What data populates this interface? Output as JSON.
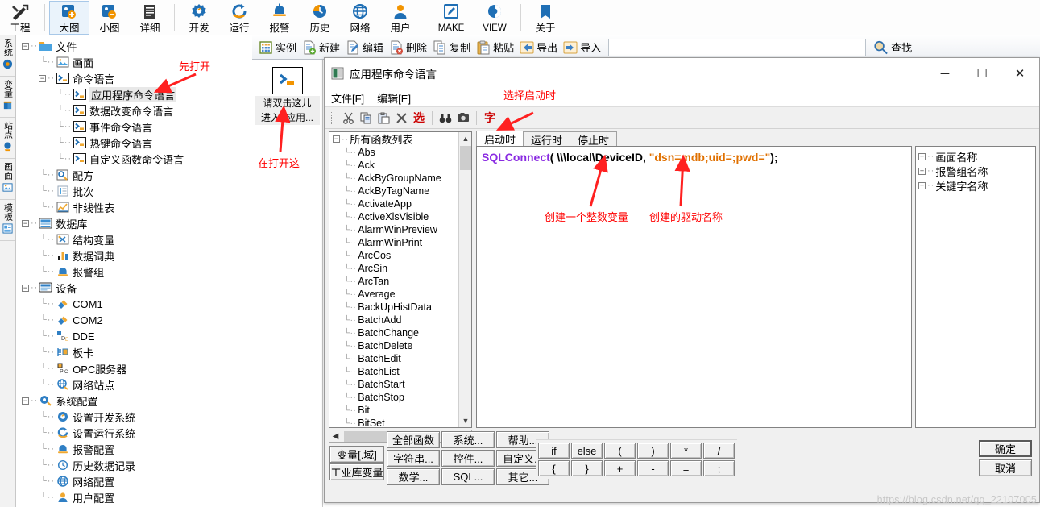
{
  "ribbon": {
    "items": [
      {
        "label": "工程",
        "icon": "tools-icon",
        "selected": false,
        "latin": false
      },
      {
        "label": "大图",
        "icon": "large-icon-view-icon",
        "selected": true,
        "latin": false
      },
      {
        "label": "小图",
        "icon": "small-icon-view-icon",
        "selected": false,
        "latin": false
      },
      {
        "label": "详细",
        "icon": "details-view-icon",
        "selected": false,
        "latin": false
      },
      {
        "label": "开发",
        "icon": "develop-icon",
        "selected": false,
        "latin": false
      },
      {
        "label": "运行",
        "icon": "run-icon",
        "selected": false,
        "latin": false
      },
      {
        "label": "报警",
        "icon": "alarm-bell-icon",
        "selected": false,
        "latin": false
      },
      {
        "label": "历史",
        "icon": "history-clock-icon",
        "selected": false,
        "latin": false
      },
      {
        "label": "网络",
        "icon": "network-globe-icon",
        "selected": false,
        "latin": false
      },
      {
        "label": "用户",
        "icon": "user-icon",
        "selected": false,
        "latin": false
      },
      {
        "label": "MAKE",
        "icon": "make-pencil-icon",
        "selected": false,
        "latin": true
      },
      {
        "label": "VIEW",
        "icon": "view-eye-icon",
        "selected": false,
        "latin": true
      },
      {
        "label": "关于",
        "icon": "about-book-icon",
        "selected": false,
        "latin": false
      }
    ]
  },
  "toolbar2": {
    "items": [
      {
        "label": "实例",
        "icon": "instance-grid-icon"
      },
      {
        "label": "新建",
        "icon": "new-file-icon"
      },
      {
        "label": "编辑",
        "icon": "edit-file-icon"
      },
      {
        "label": "删除",
        "icon": "delete-file-icon"
      },
      {
        "label": "复制",
        "icon": "copy-icon"
      },
      {
        "label": "粘贴",
        "icon": "paste-icon"
      },
      {
        "label": "导出",
        "icon": "export-arrow-icon"
      },
      {
        "label": "导入",
        "icon": "import-arrow-icon"
      }
    ],
    "search_label": "查找",
    "search_icon": "search-icon",
    "search_value": ""
  },
  "vertical_tabs": [
    {
      "label": "系统",
      "icon": "system-gear-icon"
    },
    {
      "label": "变量",
      "icon": "variable-book-icon"
    },
    {
      "label": "站点",
      "icon": "site-satellite-icon"
    },
    {
      "label": "画面",
      "icon": "picture-icon"
    },
    {
      "label": "模板",
      "icon": "template-icon"
    }
  ],
  "tree": [
    {
      "label": "文件",
      "depth": 0,
      "icon": "folder-icon",
      "expander": "minus",
      "selected": false
    },
    {
      "label": "画面",
      "depth": 1,
      "icon": "picture-icon",
      "expander": "",
      "selected": false
    },
    {
      "label": "命令语言",
      "depth": 1,
      "icon": "command-language-icon",
      "expander": "minus",
      "selected": false
    },
    {
      "label": "应用程序命令语言",
      "depth": 2,
      "icon": "command-language-icon",
      "expander": "",
      "selected": true
    },
    {
      "label": "数据改变命令语言",
      "depth": 2,
      "icon": "command-language-icon",
      "expander": "",
      "selected": false
    },
    {
      "label": "事件命令语言",
      "depth": 2,
      "icon": "command-language-icon",
      "expander": "",
      "selected": false
    },
    {
      "label": "热键命令语言",
      "depth": 2,
      "icon": "command-language-icon",
      "expander": "",
      "selected": false
    },
    {
      "label": "自定义函数命令语言",
      "depth": 2,
      "icon": "command-language-icon",
      "expander": "",
      "selected": false
    },
    {
      "label": "配方",
      "depth": 1,
      "icon": "recipe-icon",
      "expander": "",
      "selected": false
    },
    {
      "label": "批次",
      "depth": 1,
      "icon": "batch-icon",
      "expander": "",
      "selected": false
    },
    {
      "label": "非线性表",
      "depth": 1,
      "icon": "nonlinear-table-icon",
      "expander": "",
      "selected": false
    },
    {
      "label": "数据库",
      "depth": 0,
      "icon": "database-icon",
      "expander": "minus",
      "selected": false
    },
    {
      "label": "结构变量",
      "depth": 1,
      "icon": "struct-variable-icon",
      "expander": "",
      "selected": false
    },
    {
      "label": "数据词典",
      "depth": 1,
      "icon": "data-dictionary-icon",
      "expander": "",
      "selected": false
    },
    {
      "label": "报警组",
      "depth": 1,
      "icon": "alarm-group-icon",
      "expander": "",
      "selected": false
    },
    {
      "label": "设备",
      "depth": 0,
      "icon": "device-monitor-icon",
      "expander": "minus",
      "selected": false
    },
    {
      "label": "COM1",
      "depth": 1,
      "icon": "com-port-icon",
      "expander": "",
      "selected": false
    },
    {
      "label": "COM2",
      "depth": 1,
      "icon": "com-port-icon",
      "expander": "",
      "selected": false
    },
    {
      "label": "DDE",
      "depth": 1,
      "icon": "dde-icon",
      "expander": "",
      "selected": false
    },
    {
      "label": "板卡",
      "depth": 1,
      "icon": "board-card-icon",
      "expander": "",
      "selected": false
    },
    {
      "label": "OPC服务器",
      "depth": 1,
      "icon": "opc-server-icon",
      "expander": "",
      "selected": false
    },
    {
      "label": "网络站点",
      "depth": 1,
      "icon": "network-site-icon",
      "expander": "",
      "selected": false
    },
    {
      "label": "系统配置",
      "depth": 0,
      "icon": "system-config-icon",
      "expander": "minus",
      "selected": false
    },
    {
      "label": "设置开发系统",
      "depth": 1,
      "icon": "develop-icon",
      "expander": "",
      "selected": false
    },
    {
      "label": "设置运行系统",
      "depth": 1,
      "icon": "run-icon",
      "expander": "",
      "selected": false
    },
    {
      "label": "报警配置",
      "depth": 1,
      "icon": "alarm-bell-icon",
      "expander": "",
      "selected": false
    },
    {
      "label": "历史数据记录",
      "depth": 1,
      "icon": "history-clock-icon",
      "expander": "",
      "selected": false
    },
    {
      "label": "网络配置",
      "depth": 1,
      "icon": "network-globe-icon",
      "expander": "",
      "selected": false
    },
    {
      "label": "用户配置",
      "depth": 1,
      "icon": "user-icon",
      "expander": "",
      "selected": false
    }
  ],
  "instance_pane": {
    "icon": "command-language-icon",
    "line1": "请双击这儿",
    "line2": "进入<应用..."
  },
  "dialog": {
    "title": "应用程序命令语言",
    "title_icon": "app-window-icon",
    "window_buttons": {
      "minimize": "─",
      "maximize": "☐",
      "close": "✕"
    },
    "menu": [
      "文件[F]",
      "编辑[E]"
    ],
    "toolbar": [
      {
        "icon": "cut-icon",
        "kind": "icon"
      },
      {
        "icon": "copy-icon",
        "kind": "icon"
      },
      {
        "icon": "paste-icon",
        "kind": "icon"
      },
      {
        "icon": "delete-x-icon",
        "kind": "icon"
      },
      {
        "icon": "select-text-icon",
        "kind": "text",
        "label": "选"
      },
      {
        "icon": "find-binoculars-icon",
        "kind": "icon"
      },
      {
        "icon": "camera-icon",
        "kind": "icon"
      },
      {
        "icon": "font-text-icon",
        "kind": "text",
        "label": "字"
      }
    ],
    "function_list": {
      "root": "所有函数列表",
      "items": [
        "Abs",
        "Ack",
        "AckByGroupName",
        "AckByTagName",
        "ActivateApp",
        "ActiveXlsVisible",
        "AlarmWinPreview",
        "AlarmWinPrint",
        "ArcCos",
        "ArcSin",
        "ArcTan",
        "Average",
        "BackUpHistData",
        "BatchAdd",
        "BatchChange",
        "BatchDelete",
        "BatchEdit",
        "BatchList",
        "BatchStart",
        "BatchStop",
        "Bit",
        "BitSet"
      ]
    },
    "tabs": [
      {
        "label": "启动时",
        "active": true
      },
      {
        "label": "运行时",
        "active": false
      },
      {
        "label": "停止时",
        "active": false
      }
    ],
    "code": {
      "fn": "SQLConnect",
      "args_plain": "( \\\\\\local\\DeviceID, ",
      "string": "\"dsn=mdb;uid=;pwd=\"",
      "tail": ");"
    },
    "right_list": [
      {
        "label": "画面名称",
        "expander": "plus"
      },
      {
        "label": "报警组名称",
        "expander": "plus"
      },
      {
        "label": "关键字名称",
        "expander": "plus"
      }
    ],
    "var_buttons": [
      "变量[.域]",
      "工业库变量"
    ],
    "category_buttons": [
      "全部函数",
      "系统...",
      "帮助...",
      "字符串...",
      "控件...",
      "自定义...",
      "数学...",
      "SQL...",
      "其它..."
    ],
    "operator_buttons": [
      "if",
      "else",
      "(",
      ")",
      "*",
      "/",
      "{",
      "}",
      "+",
      "-",
      "=",
      ";"
    ],
    "ok_button": "确定",
    "cancel_button": "取消"
  },
  "annotations": [
    {
      "id": "open-first",
      "text": "先打开"
    },
    {
      "id": "open-here",
      "text": "在打开这"
    },
    {
      "id": "select-startup",
      "text": "选择启动时"
    },
    {
      "id": "create-int-var",
      "text": "创建一个整数变量"
    },
    {
      "id": "created-driver-name",
      "text": "创建的驱动名称"
    }
  ],
  "watermark": "https://blog.csdn.net/qq_22107005",
  "colors": {
    "accent_blue": "#1f6fb5",
    "accent_orange": "#f29400",
    "annotation_red": "#ff0000",
    "code_function": "#8a2be2",
    "code_string": "#e07000"
  }
}
